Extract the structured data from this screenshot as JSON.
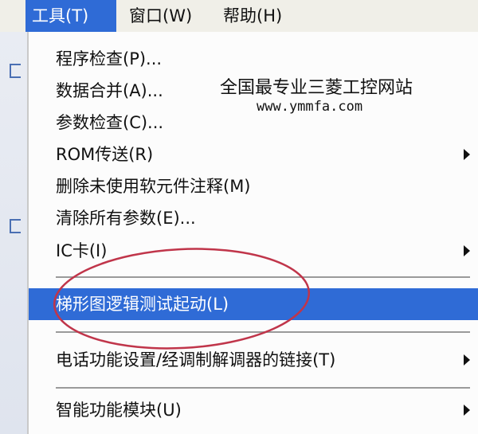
{
  "menubar": {
    "items": [
      {
        "label": "工具(T)",
        "active": true
      },
      {
        "label": "窗口(W)",
        "active": false
      },
      {
        "label": "帮助(H)",
        "active": false
      }
    ]
  },
  "menu": {
    "items": [
      {
        "label": "程序检查(P)...",
        "submenu": false
      },
      {
        "label": "数据合并(A)...",
        "submenu": false
      },
      {
        "label": "参数检查(C)...",
        "submenu": false
      },
      {
        "label": "ROM传送(R)",
        "submenu": true
      },
      {
        "label": "删除未使用软元件注释(M)",
        "submenu": false
      },
      {
        "label": "清除所有参数(E)...",
        "submenu": false
      },
      {
        "label": "IC卡(I)",
        "submenu": true
      },
      {
        "label": "梯形图逻辑测试起动(L)",
        "submenu": false,
        "highlighted": true
      },
      {
        "label": "电话功能设置/经调制解调器的链接(T)",
        "submenu": true
      },
      {
        "label": "智能功能模块(U)",
        "submenu": true
      }
    ]
  },
  "watermark": {
    "line1": "全国最专业三菱工控网站",
    "line2": "www.ymmfa.com"
  },
  "colors": {
    "highlight": "#2f6bd6",
    "annotation": "#c0354a"
  }
}
